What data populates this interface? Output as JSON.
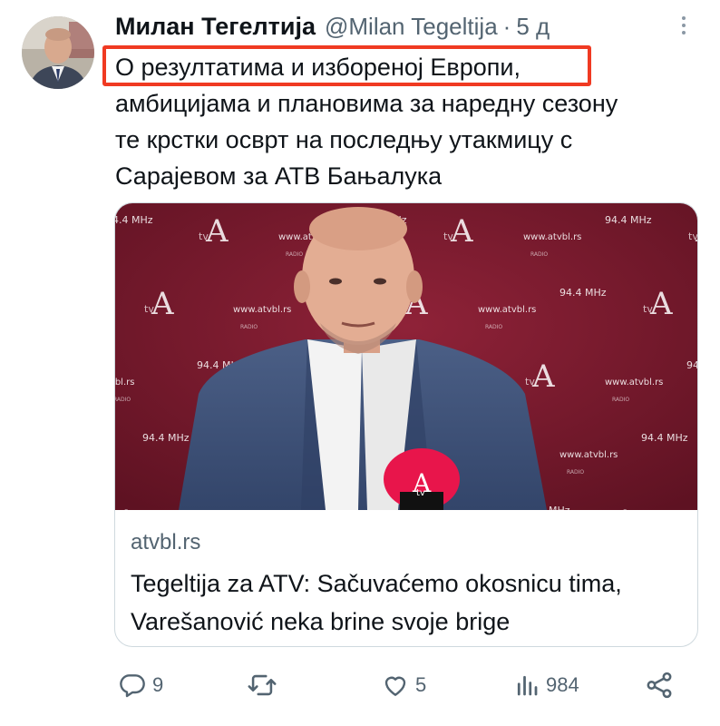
{
  "tweet": {
    "author_name": "Милан Тегелтија",
    "author_handle": "@Milan Tegeltija",
    "separator": "·",
    "time": "5 д",
    "text_lines": [
      "О резултатима и избореној Европи,",
      "амбицијама и плановима за наредну сезону",
      "те крстки осврт на последњу утакмицу с",
      "Сарајевом за АТВ Бањалука"
    ]
  },
  "highlight_color": "#f03a22",
  "card": {
    "domain": "atvbl.rs",
    "title": "Tegeltija za ATV: Sačuvaćemo okosnicu tima, Varešanović neka brine svoje brige",
    "backdrop_texts": {
      "freq": "94.4 MHz",
      "site": "www.atvbl.rs",
      "site_partial": "tvbl.rs",
      "logo_letter": "A",
      "logo_sub": "tv",
      "radio": "RADIO"
    }
  },
  "actions": {
    "replies": "9",
    "retweets": "",
    "likes": "5",
    "views": "984"
  },
  "icons": {
    "more": "more-dots-icon",
    "reply": "reply-icon",
    "retweet": "retweet-icon",
    "like": "heart-icon",
    "views": "views-icon",
    "share": "share-icon"
  },
  "colors": {
    "text": "#0f1419",
    "muted": "#536471",
    "border": "#cfd9de",
    "backdrop": "#7a1a2e"
  }
}
